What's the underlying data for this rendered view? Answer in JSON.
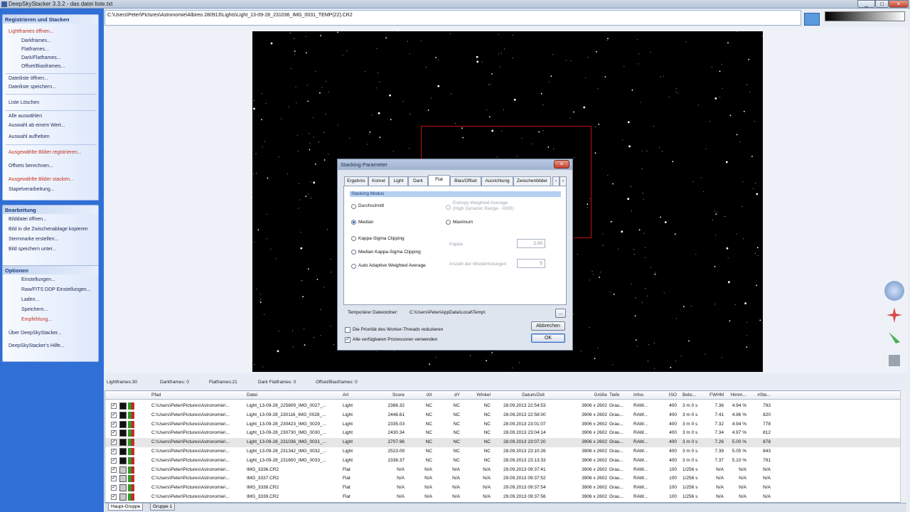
{
  "window": {
    "title": "DeepSkyStacker 3.3.2 - das datei liste.txt",
    "controls": [
      "_",
      "□",
      "×"
    ]
  },
  "sidebar": {
    "register_header": "Registrieren und Stacken",
    "items": [
      "Lightframes öffnen...",
      "Darkframes...",
      "Flatframes...",
      "Dark/Flatframes...",
      "Offset/Biasframes...",
      "Dateiliste öffnen...",
      "Dateiliste speichern...",
      "Liste Löschen",
      "Alle auswählen",
      "Auswahl ab einem Wert...",
      "Auswahl aufheben",
      "Ausgewählte Bilder registrieren...",
      "Offsets berechnen...",
      "Ausgewählte Bilder stacken...",
      "Stapelverarbeitung..."
    ],
    "edit_header": "Bearbeitung",
    "edit_items": [
      "Bilddatei öffnen...",
      "Bild in die Zwischenablage kopieren",
      "Sternmarke erstellen...",
      "Bild speichern unter..."
    ],
    "options_header": "Optionen",
    "options_items": [
      "Einstellungen...",
      "Raw/FITS DDP Einstellungen...",
      "Laden...",
      "Speichern...",
      "Empfehlung...",
      "Über DeepSkyStacker...",
      "DeepSkyStacker's Hilfe..."
    ]
  },
  "path": "C:\\Users\\Peter\\Pictures\\Astronomie\\Albireo 280913\\Lights\\Light_13-09-28_231036_IMG_0031_TEMP(22).CR2",
  "dialog": {
    "title": "Stacking Parameter",
    "close": "×",
    "tabs": [
      "Ergebnis",
      "Komet",
      "Light",
      "Dark",
      "Flat",
      "Bias/Offset",
      "Ausrichtung",
      "Zwischenbilder"
    ],
    "active_tab": "Flat",
    "section": "Stacking Modus",
    "modes": [
      "Durchschnitt",
      "Median",
      "Kappa-Sigma Clipping",
      "Median Kappa-Sigma Clipping",
      "Auto Adaptive Weighted Average"
    ],
    "entropy": "Entropy Weighted Average",
    "entropy_sub": "(High Dynamic Range - HDR)",
    "maximum": "Maximum",
    "kappa_label": "Kappa",
    "kappa_value": "2.00",
    "iter_label": "Anzahl der Wiederholungen",
    "iter_value": "5",
    "temp_label": "Temporärer Dateiordner:",
    "temp_path": "C:\\Users\\Peter\\AppData\\Local\\Temp\\",
    "browse": "...",
    "cancel": "Abbrechen",
    "ok": "OK",
    "chk1": "Die Priorität des Worker-Threads reduzieren",
    "chk2": "Alle verfügbaren Prozessoren verwenden"
  },
  "counts": [
    "Lightframes:30",
    "Darkframes: 0",
    "Flatframes:21",
    "Dark Flatframes: 0",
    "Offset/Biasframes: 0"
  ],
  "columns": [
    "Pfad",
    "Datei",
    "Art",
    "Score",
    "dX",
    "dY",
    "Winkel",
    "Datum/Zeit",
    "Größe",
    "Tiefe",
    "Infos",
    "ISO",
    "Belic...",
    "FWHM",
    "Himm...",
    "#Ste..."
  ],
  "rows": [
    [
      "C:\\Users\\Peter\\Pictures\\Astronomie\\...",
      "Light_13-09-28_225809_IMG_0027_...",
      "Light",
      "2386.32",
      "NC",
      "NC",
      "NC",
      "28.09.2013 22:54:53",
      "3906 x 2602",
      "Grau...",
      "RAW...",
      "400",
      "3 m 0 s",
      "7.36",
      "4.94 %",
      "793"
    ],
    [
      "C:\\Users\\Peter\\Pictures\\Astronomie\\...",
      "Light_13-09-28_230116_IMG_0028_...",
      "Light",
      "2446.61",
      "NC",
      "NC",
      "NC",
      "28.09.2013 22:58:00",
      "3906 x 2602",
      "Grau...",
      "RAW...",
      "400",
      "3 m 0 s",
      "7.41",
      "4.96 %",
      "820"
    ],
    [
      "C:\\Users\\Peter\\Pictures\\Astronomie\\...",
      "Light_13-09-28_230423_IMG_0029_...",
      "Light",
      "2335.03",
      "NC",
      "NC",
      "NC",
      "28.09.2013 23:01:07",
      "3906 x 2602",
      "Grau...",
      "RAW...",
      "400",
      "3 m 0 s",
      "7.32",
      "4.94 %",
      "778"
    ],
    [
      "C:\\Users\\Peter\\Pictures\\Astronomie\\...",
      "Light_13-09-28_230730_IMG_0030_...",
      "Light",
      "2430.34",
      "NC",
      "NC",
      "NC",
      "28.09.2013 23:04:14",
      "3906 x 2602",
      "Grau...",
      "RAW...",
      "400",
      "3 m 0 s",
      "7.34",
      "4.97 %",
      "812"
    ],
    [
      "C:\\Users\\Peter\\Pictures\\Astronomie\\...",
      "Light_13-09-28_231036_IMG_0031_...",
      "Light",
      "2707.96",
      "NC",
      "NC",
      "NC",
      "28.09.2013 23:07:20",
      "3906 x 2602",
      "Grau...",
      "RAW...",
      "400",
      "3 m 0 s",
      "7.26",
      "5.00 %",
      "878"
    ],
    [
      "C:\\Users\\Peter\\Pictures\\Astronomie\\...",
      "Light_13-09-28_231342_IMG_0032_...",
      "Light",
      "2523.09",
      "NC",
      "NC",
      "NC",
      "28.09.2013 23:10:26",
      "3906 x 2602",
      "Grau...",
      "RAW...",
      "400",
      "3 m 0 s",
      "7.39",
      "5.05 %",
      "843"
    ],
    [
      "C:\\Users\\Peter\\Pictures\\Astronomie\\...",
      "Light_13-09-28_231650_IMG_0033_...",
      "Light",
      "2338.37",
      "NC",
      "NC",
      "NC",
      "28.09.2013 23:13:33",
      "3906 x 2602",
      "Grau...",
      "RAW...",
      "400",
      "3 m 0 s",
      "7.37",
      "5.10 %",
      "791"
    ],
    [
      "C:\\Users\\Peter\\Pictures\\Astronomie\\...",
      "IMG_3336.CR2",
      "Flat",
      "N/A",
      "N/A",
      "N/A",
      "N/A",
      "29.09.2013 09:37:41",
      "3906 x 2602",
      "Grau...",
      "RAW...",
      "100",
      "1/256 s",
      "N/A",
      "N/A",
      "N/A"
    ],
    [
      "C:\\Users\\Peter\\Pictures\\Astronomie\\...",
      "IMG_3337.CR2",
      "Flat",
      "N/A",
      "N/A",
      "N/A",
      "N/A",
      "29.09.2013 09:37:52",
      "3906 x 2602",
      "Grau...",
      "RAW...",
      "100",
      "1/256 s",
      "N/A",
      "N/A",
      "N/A"
    ],
    [
      "C:\\Users\\Peter\\Pictures\\Astronomie\\...",
      "IMG_3338.CR2",
      "Flat",
      "N/A",
      "N/A",
      "N/A",
      "N/A",
      "29.09.2013 09:37:54",
      "3906 x 2602",
      "Grau...",
      "RAW...",
      "100",
      "1/256 s",
      "N/A",
      "N/A",
      "N/A"
    ],
    [
      "C:\\Users\\Peter\\Pictures\\Astronomie\\...",
      "IMG_3339.CR2",
      "Flat",
      "N/A",
      "N/A",
      "N/A",
      "N/A",
      "29.09.2013 09:37:56",
      "3906 x 2602",
      "Grau...",
      "RAW...",
      "100",
      "1/256 s",
      "N/A",
      "N/A",
      "N/A"
    ]
  ],
  "highlight_row": 4,
  "groups": [
    "Haupt-Gruppe",
    "Gruppe 1"
  ],
  "check": "✓",
  "colors": {
    "sidebar_bg": "#2f6fd6",
    "accent_red": "#c0311f",
    "selection": "#c01010"
  }
}
